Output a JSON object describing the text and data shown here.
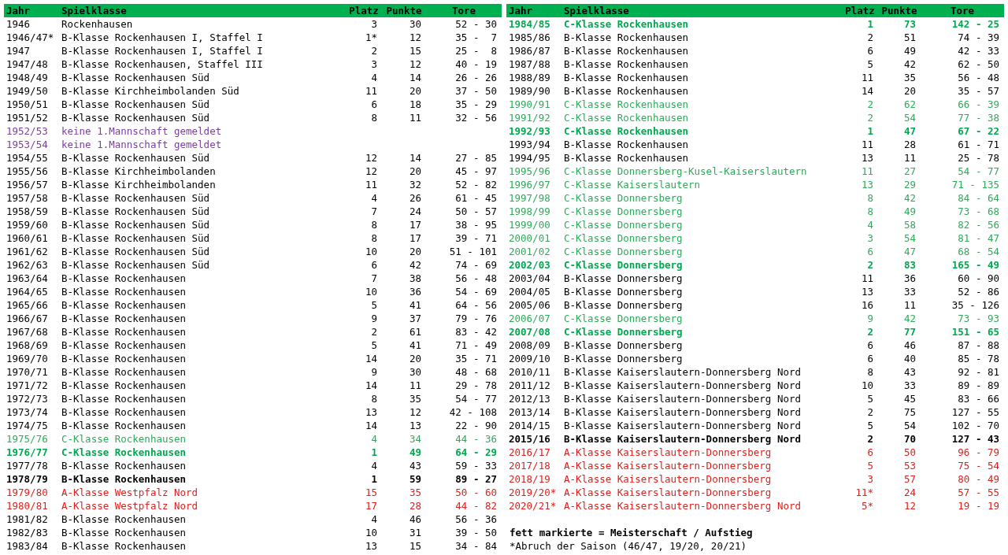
{
  "tables": [
    {
      "columns": [
        "Jahr",
        "Spielklasse",
        "Platz",
        "Punkte",
        "Tore"
      ],
      "rows": [
        {
          "jahr": "1946",
          "spielklasse": "Rockenhausen",
          "platz": "3",
          "punkte": "30",
          "tore": "52 - 30",
          "color": "#000000",
          "bold": false
        },
        {
          "jahr": "1946/47*",
          "spielklasse": "B-Klasse Rockenhausen I, Staffel I",
          "platz": "1*",
          "punkte": "12",
          "tore": "35 -  7",
          "color": "#000000",
          "bold": false
        },
        {
          "jahr": "1947",
          "spielklasse": "B-Klasse Rockenhausen I, Staffel I",
          "platz": "2",
          "punkte": "15",
          "tore": "25 -  8",
          "color": "#000000",
          "bold": false
        },
        {
          "jahr": "1947/48",
          "spielklasse": "B-Klasse Rockenhausen, Staffel III",
          "platz": "3",
          "punkte": "12",
          "tore": "40 - 19",
          "color": "#000000",
          "bold": false
        },
        {
          "jahr": "1948/49",
          "spielklasse": "B-Klasse Rockenhausen Süd",
          "platz": "4",
          "punkte": "14",
          "tore": "26 - 26",
          "color": "#000000",
          "bold": false
        },
        {
          "jahr": "1949/50",
          "spielklasse": "B-Klasse Kirchheimbolanden Süd",
          "platz": "11",
          "punkte": "20",
          "tore": "37 - 50",
          "color": "#000000",
          "bold": false
        },
        {
          "jahr": "1950/51",
          "spielklasse": "B-Klasse Rockenhausen Süd",
          "platz": "6",
          "punkte": "18",
          "tore": "35 - 29",
          "color": "#000000",
          "bold": false
        },
        {
          "jahr": "1951/52",
          "spielklasse": "B-Klasse Rockenhausen Süd",
          "platz": "8",
          "punkte": "11",
          "tore": "32 - 56",
          "color": "#000000",
          "bold": false
        },
        {
          "jahr": "1952/53",
          "spielklasse": "keine 1.Mannschaft gemeldet",
          "color": "#7b3f9e",
          "bold": false
        },
        {
          "jahr": "1953/54",
          "spielklasse": "keine 1.Mannschaft gemeldet",
          "color": "#7b3f9e",
          "bold": false
        },
        {
          "jahr": "1954/55",
          "spielklasse": "B-Klasse Rockenhausen Süd",
          "platz": "12",
          "punkte": "14",
          "tore": "27 - 85",
          "color": "#000000",
          "bold": false
        },
        {
          "jahr": "1955/56",
          "spielklasse": "B-Klasse Kirchheimbolanden",
          "platz": "12",
          "punkte": "20",
          "tore": "45 - 97",
          "color": "#000000",
          "bold": false
        },
        {
          "jahr": "1956/57",
          "spielklasse": "B-Klasse Kirchheimbolanden",
          "platz": "11",
          "punkte": "32",
          "tore": "52 - 82",
          "color": "#000000",
          "bold": false
        },
        {
          "jahr": "1957/58",
          "spielklasse": "B-Klasse Rockenhausen Süd",
          "platz": "4",
          "punkte": "26",
          "tore": "61 - 45",
          "color": "#000000",
          "bold": false
        },
        {
          "jahr": "1958/59",
          "spielklasse": "B-Klasse Rockenhausen Süd",
          "platz": "7",
          "punkte": "24",
          "tore": "50 - 57",
          "color": "#000000",
          "bold": false
        },
        {
          "jahr": "1959/60",
          "spielklasse": "B-Klasse Rockenhausen Süd",
          "platz": "8",
          "punkte": "17",
          "tore": "38 - 95",
          "color": "#000000",
          "bold": false
        },
        {
          "jahr": "1960/61",
          "spielklasse": "B-Klasse Rockenhausen Süd",
          "platz": "8",
          "punkte": "17",
          "tore": "39 - 71",
          "color": "#000000",
          "bold": false
        },
        {
          "jahr": "1961/62",
          "spielklasse": "B-Klasse Rockenhausen Süd",
          "platz": "10",
          "punkte": "20",
          "tore": "51 - 101",
          "color": "#000000",
          "bold": false
        },
        {
          "jahr": "1962/63",
          "spielklasse": "B-Klasse Rockenhausen Süd",
          "platz": "6",
          "punkte": "42",
          "tore": "74 - 69",
          "color": "#000000",
          "bold": false
        },
        {
          "jahr": "1963/64",
          "spielklasse": "B-Klasse Rockenhausen",
          "platz": "7",
          "punkte": "38",
          "tore": "56 - 48",
          "color": "#000000",
          "bold": false
        },
        {
          "jahr": "1964/65",
          "spielklasse": "B-Klasse Rockenhausen",
          "platz": "10",
          "punkte": "36",
          "tore": "54 - 69",
          "color": "#000000",
          "bold": false
        },
        {
          "jahr": "1965/66",
          "spielklasse": "B-Klasse Rockenhausen",
          "platz": "5",
          "punkte": "41",
          "tore": "64 - 56",
          "color": "#000000",
          "bold": false
        },
        {
          "jahr": "1966/67",
          "spielklasse": "B-Klasse Rockenhausen",
          "platz": "9",
          "punkte": "37",
          "tore": "79 - 76",
          "color": "#000000",
          "bold": false
        },
        {
          "jahr": "1967/68",
          "spielklasse": "B-Klasse Rockenhausen",
          "platz": "2",
          "punkte": "61",
          "tore": "83 - 42",
          "color": "#000000",
          "bold": false
        },
        {
          "jahr": "1968/69",
          "spielklasse": "B-Klasse Rockenhausen",
          "platz": "5",
          "punkte": "41",
          "tore": "71 - 49",
          "color": "#000000",
          "bold": false
        },
        {
          "jahr": "1969/70",
          "spielklasse": "B-Klasse Rockenhausen",
          "platz": "14",
          "punkte": "20",
          "tore": "35 - 71",
          "color": "#000000",
          "bold": false
        },
        {
          "jahr": "1970/71",
          "spielklasse": "B-Klasse Rockenhausen",
          "platz": "9",
          "punkte": "30",
          "tore": "48 - 68",
          "color": "#000000",
          "bold": false
        },
        {
          "jahr": "1971/72",
          "spielklasse": "B-Klasse Rockenhausen",
          "platz": "14",
          "punkte": "11",
          "tore": "29 - 78",
          "color": "#000000",
          "bold": false
        },
        {
          "jahr": "1972/73",
          "spielklasse": "B-Klasse Rockenhausen",
          "platz": "8",
          "punkte": "35",
          "tore": "54 - 77",
          "color": "#000000",
          "bold": false
        },
        {
          "jahr": "1973/74",
          "spielklasse": "B-Klasse Rockenhausen",
          "platz": "13",
          "punkte": "12",
          "tore": "42 - 108",
          "color": "#000000",
          "bold": false
        },
        {
          "jahr": "1974/75",
          "spielklasse": "B-Klasse Rockenhausen",
          "platz": "14",
          "punkte": "13",
          "tore": "22 - 90",
          "color": "#000000",
          "bold": false
        },
        {
          "jahr": "1975/76",
          "spielklasse": "C-Klasse Rockenhausen",
          "platz": "4",
          "punkte": "34",
          "tore": "44 - 36",
          "color": "#2eab5a",
          "bold": false
        },
        {
          "jahr": "1976/77",
          "spielklasse": "C-Klasse Rockenhausen",
          "platz": "1",
          "punkte": "49",
          "tore": "64 - 29",
          "color": "#00a84f",
          "bold": true
        },
        {
          "jahr": "1977/78",
          "spielklasse": "B-Klasse Rockenhausen",
          "platz": "4",
          "punkte": "43",
          "tore": "59 - 33",
          "color": "#000000",
          "bold": false
        },
        {
          "jahr": "1978/79",
          "spielklasse": "B-Klasse Rockenhausen",
          "platz": "1",
          "punkte": "59",
          "tore": "89 - 27",
          "color": "#000000",
          "bold": true
        },
        {
          "jahr": "1979/80",
          "spielklasse": "A-Klasse Westpfalz Nord",
          "platz": "15",
          "punkte": "35",
          "tore": "50 - 60",
          "color": "#e0201c",
          "bold": false
        },
        {
          "jahr": "1980/81",
          "spielklasse": "A-Klasse Westpfalz Nord",
          "platz": "17",
          "punkte": "28",
          "tore": "44 - 82",
          "color": "#e0201c",
          "bold": false
        },
        {
          "jahr": "1981/82",
          "spielklasse": "B-Klasse Rockenhausen",
          "platz": "4",
          "punkte": "46",
          "tore": "56 - 36",
          "color": "#000000",
          "bold": false
        },
        {
          "jahr": "1982/83",
          "spielklasse": "B-Klasse Rockenhausen",
          "platz": "10",
          "punkte": "31",
          "tore": "39 - 50",
          "color": "#000000",
          "bold": false
        },
        {
          "jahr": "1983/84",
          "spielklasse": "B-Klasse Rockenhausen",
          "platz": "13",
          "punkte": "15",
          "tore": "34 - 84",
          "color": "#000000",
          "bold": false
        }
      ]
    },
    {
      "columns": [
        "Jahr",
        "Spielklasse",
        "Platz",
        "Punkte",
        "Tore"
      ],
      "rows": [
        {
          "jahr": "1984/85",
          "spielklasse": "C-Klasse Rockenhausen",
          "platz": "1",
          "punkte": "73",
          "tore": "142 - 25",
          "color": "#00a84f",
          "bold": true
        },
        {
          "jahr": "1985/86",
          "spielklasse": "B-Klasse Rockenhausen",
          "platz": "2",
          "punkte": "51",
          "tore": "74 - 39",
          "color": "#000000",
          "bold": false
        },
        {
          "jahr": "1986/87",
          "spielklasse": "B-Klasse Rockenhausen",
          "platz": "6",
          "punkte": "49",
          "tore": "42 - 33",
          "color": "#000000",
          "bold": false
        },
        {
          "jahr": "1987/88",
          "spielklasse": "B-Klasse Rockenhausen",
          "platz": "5",
          "punkte": "42",
          "tore": "62 - 50",
          "color": "#000000",
          "bold": false
        },
        {
          "jahr": "1988/89",
          "spielklasse": "B-Klasse Rockenhausen",
          "platz": "11",
          "punkte": "35",
          "tore": "56 - 48",
          "color": "#000000",
          "bold": false
        },
        {
          "jahr": "1989/90",
          "spielklasse": "B-Klasse Rockenhausen",
          "platz": "14",
          "punkte": "20",
          "tore": "35 - 57",
          "color": "#000000",
          "bold": false
        },
        {
          "jahr": "1990/91",
          "spielklasse": "C-Klasse Rockenhausen",
          "platz": "2",
          "punkte": "62",
          "tore": "66 - 39",
          "color": "#2eab5a",
          "bold": false
        },
        {
          "jahr": "1991/92",
          "spielklasse": "C-Klasse Rockenhausen",
          "platz": "2",
          "punkte": "54",
          "tore": "77 - 38",
          "color": "#2eab5a",
          "bold": false
        },
        {
          "jahr": "1992/93",
          "spielklasse": "C-Klasse Rockenhausen",
          "platz": "1",
          "punkte": "47",
          "tore": "67 - 22",
          "color": "#00a84f",
          "bold": true
        },
        {
          "jahr": "1993/94",
          "spielklasse": "B-Klasse Rockenhausen",
          "platz": "11",
          "punkte": "28",
          "tore": "61 - 71",
          "color": "#000000",
          "bold": false
        },
        {
          "jahr": "1994/95",
          "spielklasse": "B-Klasse Rockenhausen",
          "platz": "13",
          "punkte": "11",
          "tore": "25 - 78",
          "color": "#000000",
          "bold": false
        },
        {
          "jahr": "1995/96",
          "spielklasse": "C-Klasse Donnersberg-Kusel-Kaiserslautern",
          "platz": "11",
          "punkte": "27",
          "tore": "54 - 77",
          "color": "#2eab5a",
          "bold": false
        },
        {
          "jahr": "1996/97",
          "spielklasse": "C-Klasse Kaiserslautern",
          "platz": "13",
          "punkte": "29",
          "tore": "71 - 135",
          "color": "#2eab5a",
          "bold": false
        },
        {
          "jahr": "1997/98",
          "spielklasse": "C-Klasse Donnersberg",
          "platz": "8",
          "punkte": "42",
          "tore": "84 - 64",
          "color": "#2eab5a",
          "bold": false
        },
        {
          "jahr": "1998/99",
          "spielklasse": "C-Klasse Donnersberg",
          "platz": "8",
          "punkte": "49",
          "tore": "73 - 68",
          "color": "#2eab5a",
          "bold": false
        },
        {
          "jahr": "1999/00",
          "spielklasse": "C-Klasse Donnersberg",
          "platz": "4",
          "punkte": "58",
          "tore": "82 - 56",
          "color": "#2eab5a",
          "bold": false
        },
        {
          "jahr": "2000/01",
          "spielklasse": "C-Klasse Donnersberg",
          "platz": "3",
          "punkte": "54",
          "tore": "81 - 47",
          "color": "#2eab5a",
          "bold": false
        },
        {
          "jahr": "2001/02",
          "spielklasse": "C-Klasse Donnersberg",
          "platz": "6",
          "punkte": "47",
          "tore": "68 - 54",
          "color": "#2eab5a",
          "bold": false
        },
        {
          "jahr": "2002/03",
          "spielklasse": "C-Klasse Donnersberg",
          "platz": "2",
          "punkte": "83",
          "tore": "165 - 49",
          "color": "#00a84f",
          "bold": true
        },
        {
          "jahr": "2003/04",
          "spielklasse": "B-Klasse Donnersberg",
          "platz": "11",
          "punkte": "36",
          "tore": "60 - 90",
          "color": "#000000",
          "bold": false
        },
        {
          "jahr": "2004/05",
          "spielklasse": "B-Klasse Donnersberg",
          "platz": "13",
          "punkte": "33",
          "tore": "52 - 86",
          "color": "#000000",
          "bold": false
        },
        {
          "jahr": "2005/06",
          "spielklasse": "B-Klasse Donnersberg",
          "platz": "16",
          "punkte": "11",
          "tore": "35 - 126",
          "color": "#000000",
          "bold": false
        },
        {
          "jahr": "2006/07",
          "spielklasse": "C-Klasse Donnersberg",
          "platz": "9",
          "punkte": "42",
          "tore": "73 - 93",
          "color": "#2eab5a",
          "bold": false
        },
        {
          "jahr": "2007/08",
          "spielklasse": "C-Klasse Donnersberg",
          "platz": "2",
          "punkte": "77",
          "tore": "151 - 65",
          "color": "#00a84f",
          "bold": true
        },
        {
          "jahr": "2008/09",
          "spielklasse": "B-Klasse Donnersberg",
          "platz": "6",
          "punkte": "46",
          "tore": "87 - 88",
          "color": "#000000",
          "bold": false
        },
        {
          "jahr": "2009/10",
          "spielklasse": "B-Klasse Donnersberg",
          "platz": "6",
          "punkte": "40",
          "tore": "85 - 78",
          "color": "#000000",
          "bold": false
        },
        {
          "jahr": "2010/11",
          "spielklasse": "B-Klasse Kaiserslautern-Donnersberg Nord",
          "platz": "8",
          "punkte": "43",
          "tore": "92 - 81",
          "color": "#000000",
          "bold": false
        },
        {
          "jahr": "2011/12",
          "spielklasse": "B-Klasse Kaiserslautern-Donnersberg Nord",
          "platz": "10",
          "punkte": "33",
          "tore": "89 - 89",
          "color": "#000000",
          "bold": false
        },
        {
          "jahr": "2012/13",
          "spielklasse": "B-Klasse Kaiserslautern-Donnersberg Nord",
          "platz": "5",
          "punkte": "45",
          "tore": "83 - 66",
          "color": "#000000",
          "bold": false
        },
        {
          "jahr": "2013/14",
          "spielklasse": "B-Klasse Kaiserslautern-Donnersberg Nord",
          "platz": "2",
          "punkte": "75",
          "tore": "127 - 55",
          "color": "#000000",
          "bold": false
        },
        {
          "jahr": "2014/15",
          "spielklasse": "B-Klasse Kaiserslautern-Donnersberg Nord",
          "platz": "5",
          "punkte": "54",
          "tore": "102 - 70",
          "color": "#000000",
          "bold": false
        },
        {
          "jahr": "2015/16",
          "spielklasse": "B-Klasse Kaiserslautern-Donnersberg Nord",
          "platz": "2",
          "punkte": "70",
          "tore": "127 - 43",
          "color": "#000000",
          "bold": true
        },
        {
          "jahr": "2016/17",
          "spielklasse": "A-Klasse Kaiserslautern-Donnersberg",
          "platz": "6",
          "punkte": "50",
          "tore": "96 - 79",
          "color": "#e0201c",
          "bold": false
        },
        {
          "jahr": "2017/18",
          "spielklasse": "A-Klasse Kaiserslautern-Donnersberg",
          "platz": "5",
          "punkte": "53",
          "tore": "75 - 54",
          "color": "#e0201c",
          "bold": false
        },
        {
          "jahr": "2018/19",
          "spielklasse": "A-Klasse Kaiserslautern-Donnersberg",
          "platz": "3",
          "punkte": "57",
          "tore": "80 - 49",
          "color": "#e0201c",
          "bold": false
        },
        {
          "jahr": "2019/20*",
          "spielklasse": "A-Klasse Kaiserslautern-Donnersberg",
          "platz": "11*",
          "punkte": "24",
          "tore": "57 - 55",
          "color": "#e0201c",
          "bold": false
        },
        {
          "jahr": "2020/21*",
          "spielklasse": "A-Klasse Kaiserslautern-Donnersberg Nord",
          "platz": "5*",
          "punkte": "12",
          "tore": "19 - 19",
          "color": "#e0201c",
          "bold": false
        }
      ]
    }
  ],
  "legend": {
    "title": "fett markierte = Meisterschaft / Aufstieg",
    "note": "*Abruch der Saison (46/47, 19/20, 20/21)"
  }
}
